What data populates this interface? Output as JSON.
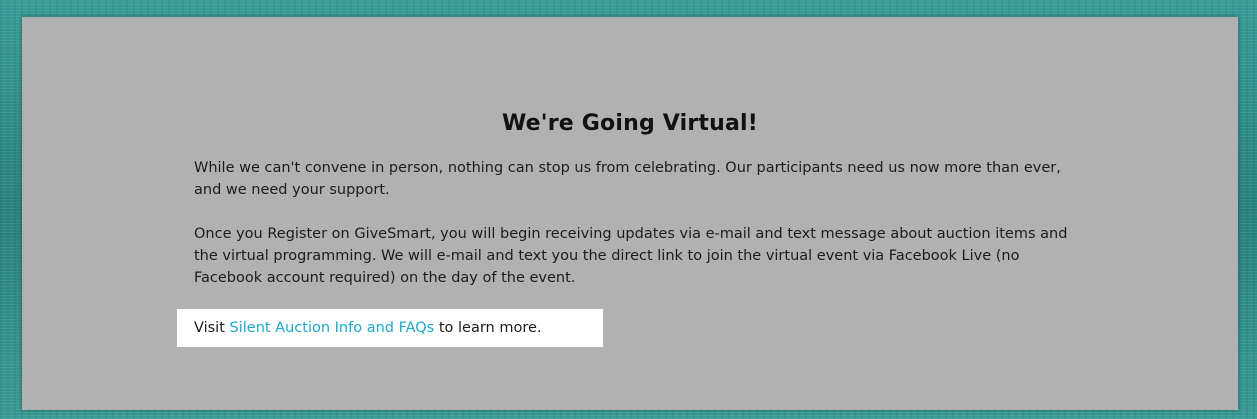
{
  "banner": {
    "heading": "We're Going Virtual!",
    "paragraph_1": "While we can't convene in person, nothing can stop us from celebrating. Our participants need us now more than ever, and we need your support.",
    "paragraph_2": "Once you Register on GiveSmart, you will begin receiving updates via e-mail and text message about auction items and the virtual programming. We will e-mail and text you the direct link to join the virtual event via Facebook Live (no Facebook account required) on the day of the event.",
    "visit_prefix": "Visit ",
    "visit_link_text": "Silent Auction Info and FAQs",
    "visit_suffix": " to learn more."
  },
  "colors": {
    "background_teal": "#2f8f8c",
    "panel_gray": "#b1b1b1",
    "highlight_white": "#ffffff",
    "link_blue": "#1ba9cf",
    "text_dark": "#1c1c1c"
  }
}
